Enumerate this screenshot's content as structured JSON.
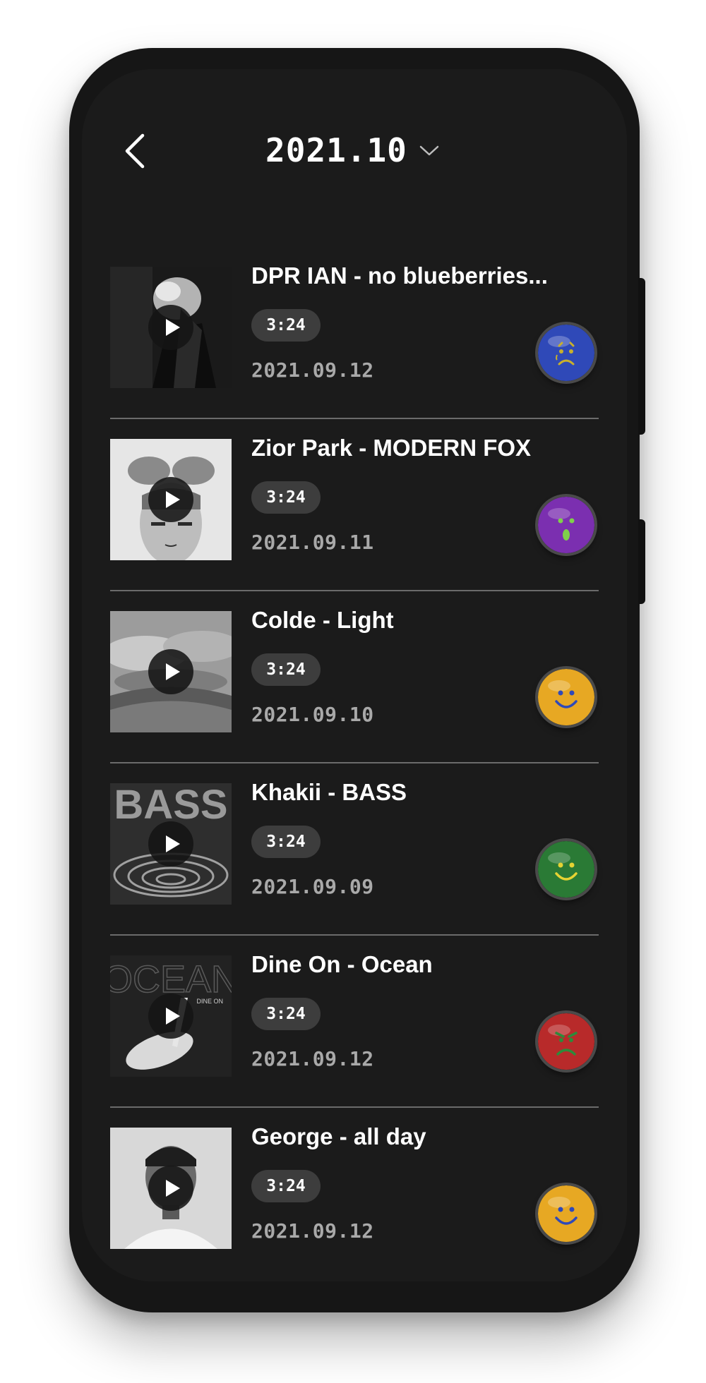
{
  "header": {
    "title": "2021.10"
  },
  "icons": {
    "back": "chevron-left-icon",
    "dropdown": "chevron-down-icon",
    "play": "play-icon"
  },
  "items": [
    {
      "title": "DPR IAN - no blueberries...",
      "duration": "3:24",
      "date": "2021.09.12",
      "mood": "sad",
      "mood_color": "#2f49b8"
    },
    {
      "title": "Zior Park - MODERN FOX",
      "duration": "3:24",
      "date": "2021.09.11",
      "mood": "surprised",
      "mood_color": "#7b2fb0"
    },
    {
      "title": "Colde - Light",
      "duration": "3:24",
      "date": "2021.09.10",
      "mood": "happy",
      "mood_color": "#e7a823"
    },
    {
      "title": "Khakii - BASS",
      "duration": "3:24",
      "date": "2021.09.09",
      "mood": "happy",
      "mood_color": "#2a7a35"
    },
    {
      "title": "Dine On - Ocean",
      "duration": "3:24",
      "date": "2021.09.12",
      "mood": "angry",
      "mood_color": "#b82a2a"
    },
    {
      "title": "George - all day",
      "duration": "3:24",
      "date": "2021.09.12",
      "mood": "happy",
      "mood_color": "#e7a823"
    }
  ],
  "album_art_text": {
    "bass": "BASS",
    "ocean": "OCEAN",
    "ocean_sub": "DINE ON"
  }
}
